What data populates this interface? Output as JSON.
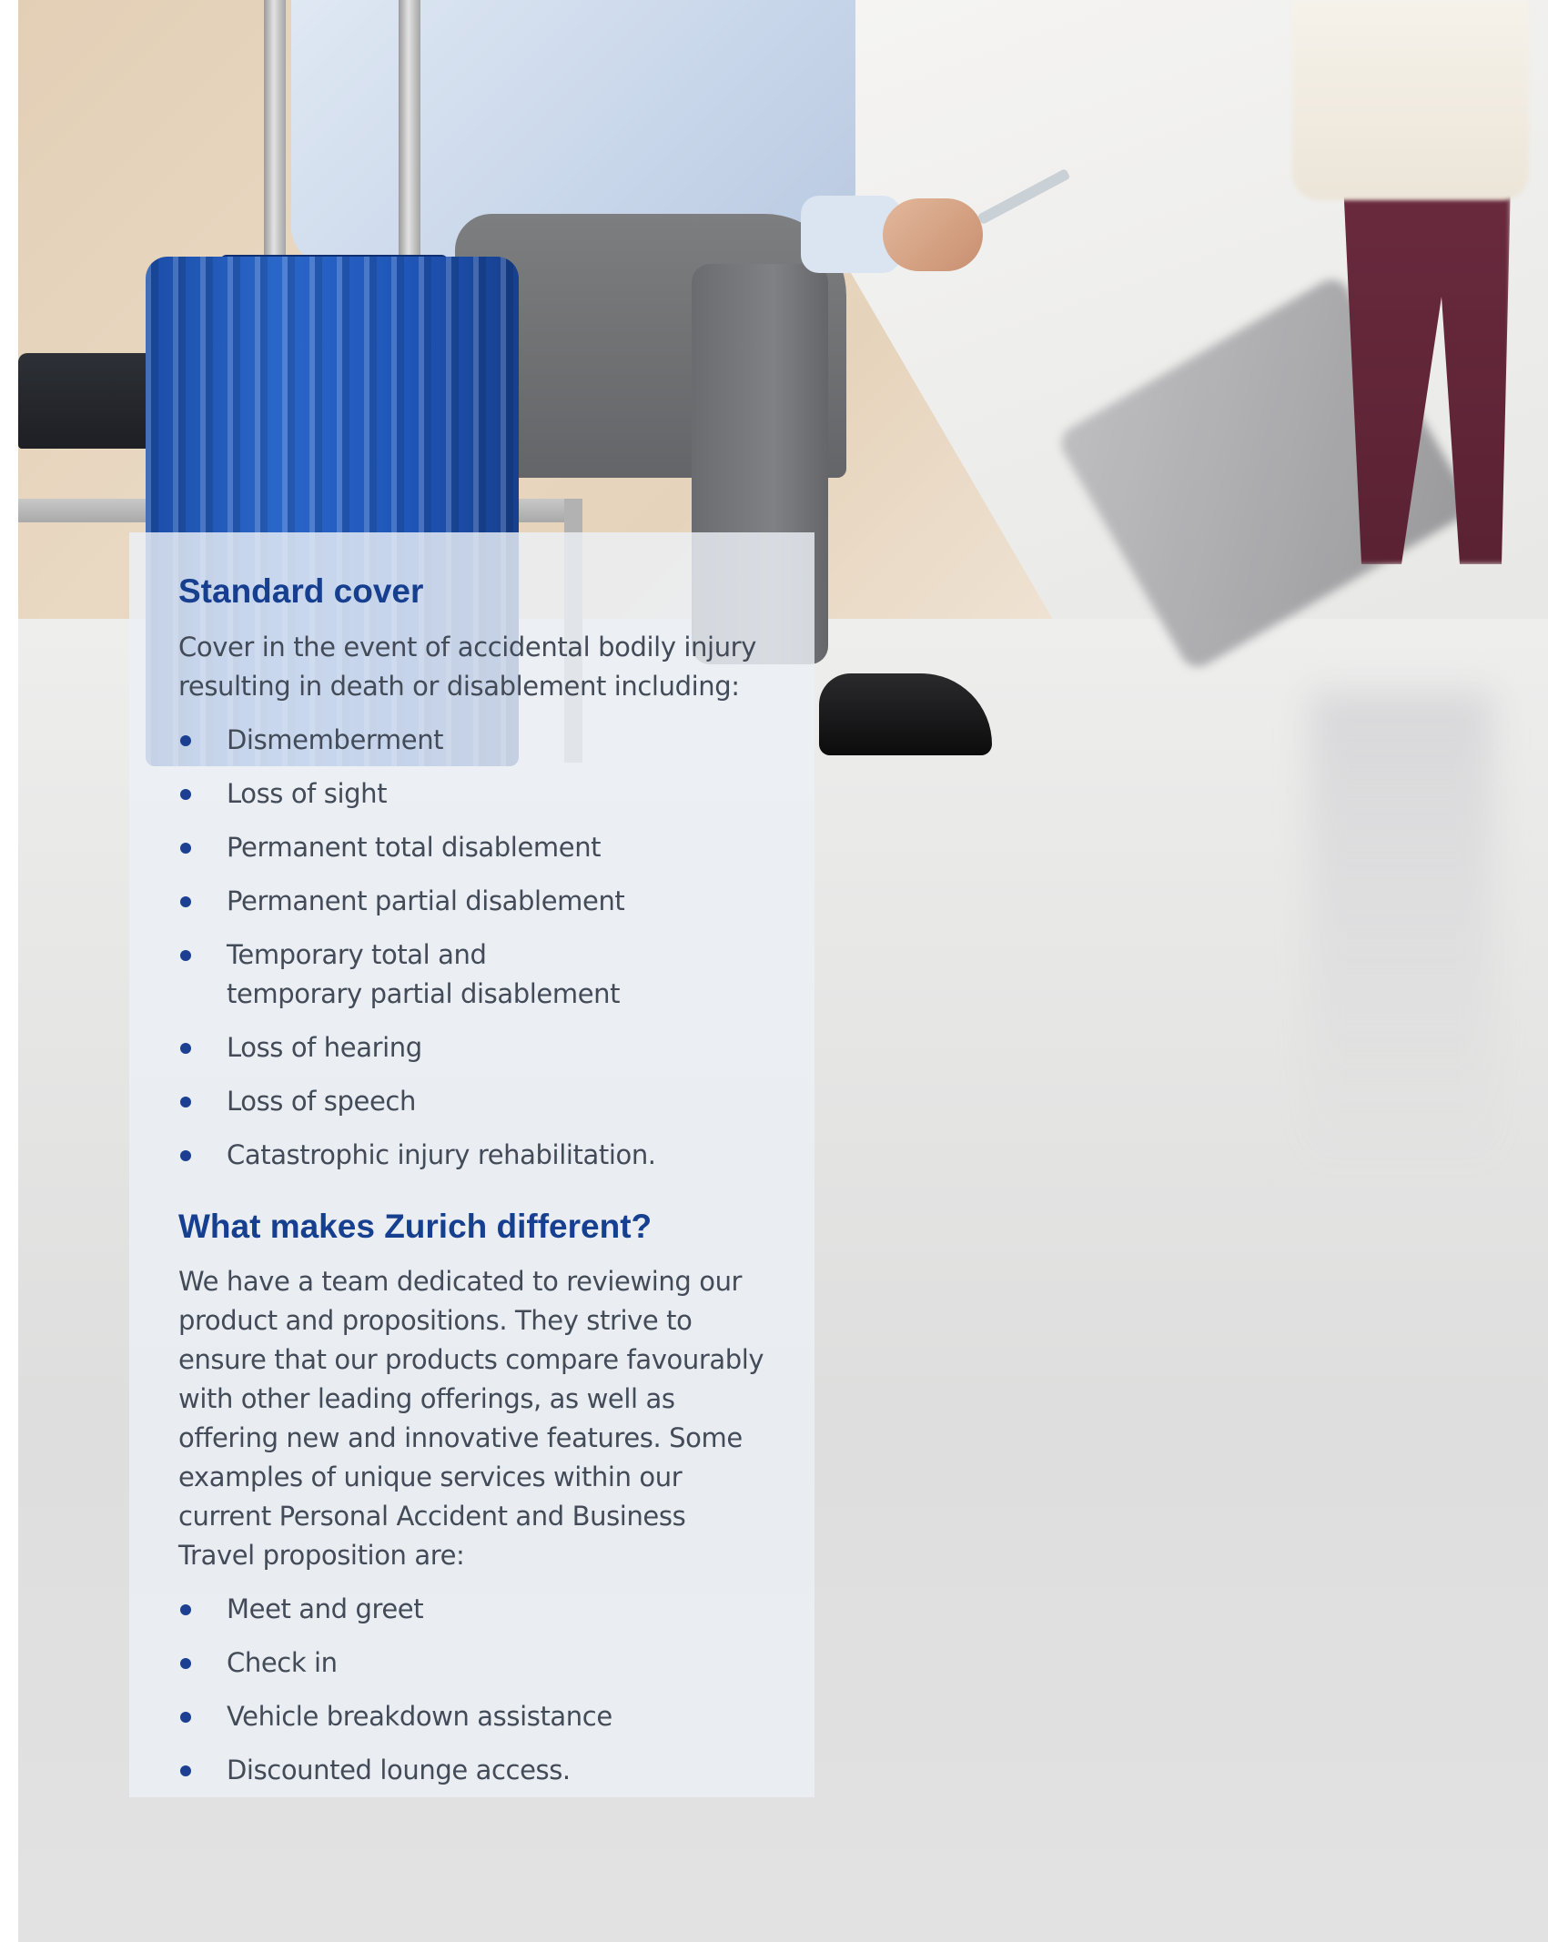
{
  "photo": {
    "description_icon": "airport-travellers-photo"
  },
  "standard_cover": {
    "heading": "Standard cover",
    "intro": "Cover in the event of accidental bodily injury resulting in death or disablement including:",
    "items": [
      "Dismemberment",
      "Loss of sight",
      "Permanent total disablement",
      "Permanent partial disablement",
      "Temporary total and temporary partial disablement",
      "Loss of hearing",
      "Loss of speech",
      "Catastrophic injury rehabilitation."
    ]
  },
  "zurich_different": {
    "heading": "What makes Zurich different?",
    "body": "We have a team dedicated to reviewing our product and propositions. They strive to ensure that our products compare favourably with other leading offerings, as well as offering new and innovative features. Some examples of unique services within our current Personal Accident and Business Travel proposition are:",
    "items": [
      "Meet and greet",
      "Check in",
      "Vehicle breakdown assistance",
      "Discounted lounge access."
    ]
  },
  "colors": {
    "heading": "#173f8f",
    "bullet": "#1c3f92",
    "text": "#424b57",
    "panel": "#ecf0f6"
  }
}
